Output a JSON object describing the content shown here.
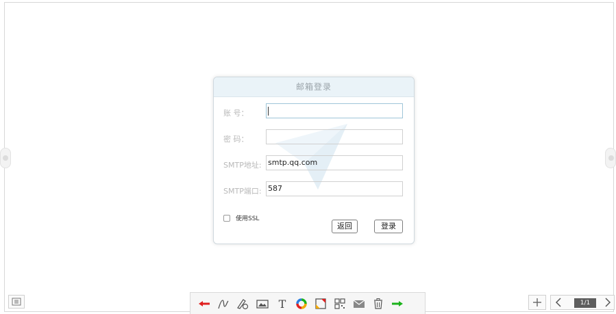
{
  "dialog": {
    "title": "邮箱登录",
    "account_label": "账 号：",
    "account_value": "",
    "password_label": "密 码：",
    "password_value": "",
    "smtp_host_label": "SMTP地址:",
    "smtp_host_value": "smtp.qq.com",
    "smtp_port_label": "SMTP端口:",
    "smtp_port_value": "587",
    "ssl_label": "使用SSL",
    "ssl_checked": false,
    "back_label": "返回",
    "login_label": "登录"
  },
  "toolbar": {
    "tools": [
      "undo-arrow-icon",
      "pen-icon",
      "pen-eraser-icon",
      "image-icon",
      "text-icon",
      "color-wheel-icon",
      "shape-icon",
      "qr-code-icon",
      "mail-icon",
      "trash-icon",
      "redo-arrow-icon"
    ],
    "accent_red": "#e02020",
    "accent_green": "#1bb31b"
  },
  "pager": {
    "page_indicator": "1/1"
  }
}
